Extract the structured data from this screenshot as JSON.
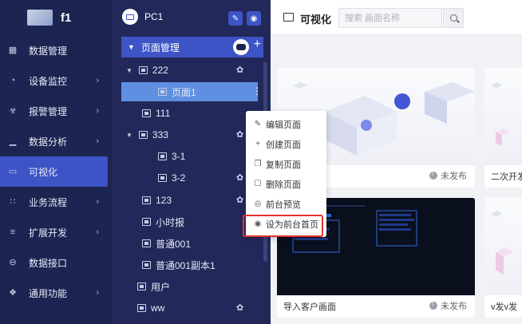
{
  "brand": {
    "name": "f1"
  },
  "nav": {
    "items": [
      {
        "label": "数据管理",
        "icon": "dashboard-icon",
        "has_arrow": false
      },
      {
        "label": "设备监控",
        "icon": "monitor-icon",
        "has_arrow": true
      },
      {
        "label": "报警管理",
        "icon": "alarm-icon",
        "has_arrow": true
      },
      {
        "label": "数据分析",
        "icon": "bar-chart-icon",
        "has_arrow": true
      },
      {
        "label": "可视化",
        "icon": "screen-icon",
        "has_arrow": false,
        "active": true
      },
      {
        "label": "业务流程",
        "icon": "flow-icon",
        "has_arrow": true
      },
      {
        "label": "扩展开发",
        "icon": "code-icon",
        "has_arrow": true
      },
      {
        "label": "数据接口",
        "icon": "plug-icon",
        "has_arrow": false
      },
      {
        "label": "通用功能",
        "icon": "grid-icon",
        "has_arrow": true
      }
    ]
  },
  "project": {
    "name": "PC1",
    "status_color": "#2ecc40"
  },
  "tree": {
    "header": "页面管理",
    "rows": [
      {
        "label": "222",
        "expanded": true,
        "palette": true
      },
      {
        "label": "页面1",
        "selected": true
      },
      {
        "label": "111"
      },
      {
        "label": "333",
        "expanded": true,
        "palette": true
      },
      {
        "label": "3-1"
      },
      {
        "label": "3-2",
        "palette": true
      },
      {
        "label": "123",
        "palette": true
      },
      {
        "label": "小时报"
      },
      {
        "label": "普通001"
      },
      {
        "label": "普通001副本1"
      },
      {
        "label": "用户"
      },
      {
        "label": "ww",
        "palette": true
      }
    ]
  },
  "context_menu": {
    "items": [
      {
        "label": "编辑页面",
        "icon": "edit-icon"
      },
      {
        "label": "创建页面",
        "icon": "plus-icon"
      },
      {
        "label": "复制页面",
        "icon": "copy-icon"
      },
      {
        "label": "删除页面",
        "icon": "trash-icon"
      },
      {
        "label": "前台预览",
        "icon": "eye-icon"
      },
      {
        "label": "设为前台首页",
        "icon": "radio-icon",
        "highlighted": true
      }
    ]
  },
  "main": {
    "title": "可视化",
    "search_placeholder": "搜索 画面名称",
    "cards": [
      {
        "name": "",
        "status": "未发布"
      },
      {
        "name": "二次开发",
        "status": ""
      },
      {
        "name": "导入客户画面",
        "status": "未发布"
      },
      {
        "name": "v发v发",
        "status": ""
      }
    ]
  },
  "colors": {
    "nav_bg": "#1c2451",
    "accent": "#3d54c6",
    "highlight": "#e53030"
  }
}
